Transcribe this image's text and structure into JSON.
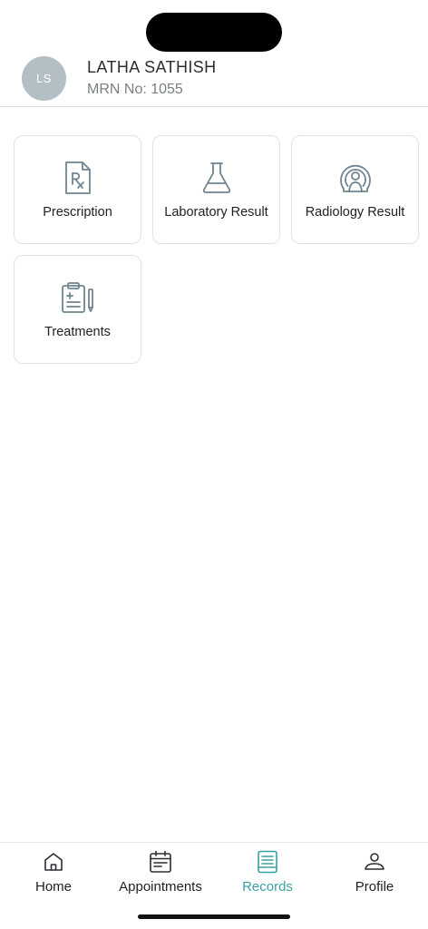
{
  "patient": {
    "initials": "LS",
    "name": "LATHA SATHISH",
    "mrn": "MRN No: 1055"
  },
  "records": {
    "tiles": [
      {
        "label": "Prescription",
        "icon": "prescription-icon"
      },
      {
        "label": "Laboratory Result",
        "icon": "flask-icon"
      },
      {
        "label": "Radiology Result",
        "icon": "radiology-scanner-icon"
      },
      {
        "label": "Treatments",
        "icon": "clipboard-pencil-icon"
      }
    ]
  },
  "tab_bar": {
    "active": "Records",
    "active_color": "#3a9fa4",
    "items": [
      {
        "label": "Home",
        "icon": "home-icon"
      },
      {
        "label": "Appointments",
        "icon": "calendar-icon"
      },
      {
        "label": "Records",
        "icon": "document-icon"
      },
      {
        "label": "Profile",
        "icon": "person-icon"
      }
    ]
  },
  "colors": {
    "icon_gray": "#6f8591",
    "accent": "#3a9fa4",
    "avatar_bg": "#b3bec5"
  }
}
